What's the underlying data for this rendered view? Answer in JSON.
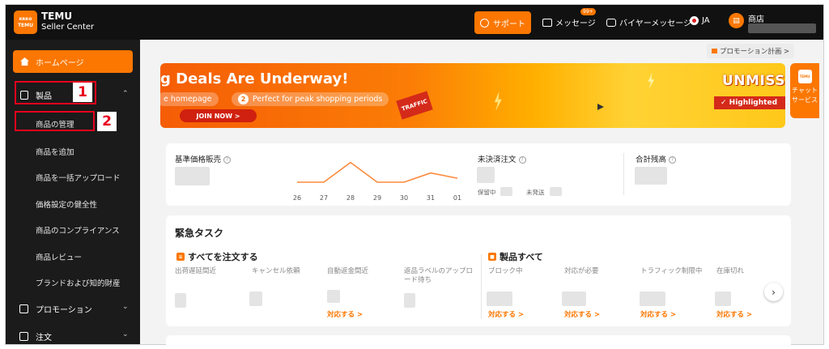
{
  "header": {
    "logo_line1": "ᴋʀʀᴏ",
    "logo_line2": "TEMU",
    "brand_title": "TEMU",
    "brand_subtitle": "Seller Center",
    "support_label": "サポート",
    "messages_label": "メッセージ",
    "messages_badge": "99+",
    "buyer_messages_label": "バイヤーメッセージ",
    "language": "JA",
    "store_label": "商店"
  },
  "sidebar": {
    "home_label": "ホームページ",
    "products_label": "製品",
    "sub_items": [
      "商品の管理",
      "商品を追加",
      "商品を一括アップロード",
      "価格設定の健全性",
      "商品のコンプライアンス",
      "商品レビュー",
      "ブランドおよび知的財産"
    ],
    "promotion_label": "プロモーション",
    "orders_label": "注文",
    "annotation_1": "1",
    "annotation_2": "2"
  },
  "main": {
    "promo_plan_link": "プロモーション計画 >",
    "banner": {
      "title": "g Deals Are Underway!",
      "pill1": "e homepage",
      "pill2_num": "2",
      "pill2": "Perfect for peak shopping periods",
      "join": "JOIN NOW >",
      "traffic": "TRAFFIC",
      "unmiss": "UNMISSA",
      "highlighted": "✓ Highlighted"
    },
    "chat": {
      "logo": "TEMU",
      "line1": "チャット",
      "line2": "サービス"
    },
    "stats": {
      "sales_label": "基準価格販売",
      "unsettled_label": "未決済注文",
      "balance_label": "合計残高",
      "on_hold": "保留中",
      "unsent": "未発送"
    },
    "urgent": {
      "title": "緊急タスク",
      "group1_title": "すべてを注文する",
      "group2_title": "製品すべて",
      "order_cols": [
        "出荷遅延間近",
        "キャンセル依頼",
        "自動返金間近",
        "返品ラベルのアップロード待ち"
      ],
      "product_cols": [
        "ブロック中",
        "対応が必要",
        "トラフィック制限中",
        "在庫切れ"
      ],
      "action_label": "対応する >"
    }
  },
  "chart_data": {
    "type": "line",
    "categories": [
      "26",
      "27",
      "28",
      "29",
      "30",
      "31",
      "01"
    ],
    "values": [
      0,
      0,
      3,
      0,
      0,
      1.4,
      0.6
    ],
    "ylim": [
      0,
      3.2
    ],
    "grid": false,
    "color": "#fb8a3c"
  },
  "colors": {
    "accent": "#fb7701",
    "annotation": "#e8001c",
    "sidebar": "#1b1b1b",
    "topbar": "#111111"
  }
}
